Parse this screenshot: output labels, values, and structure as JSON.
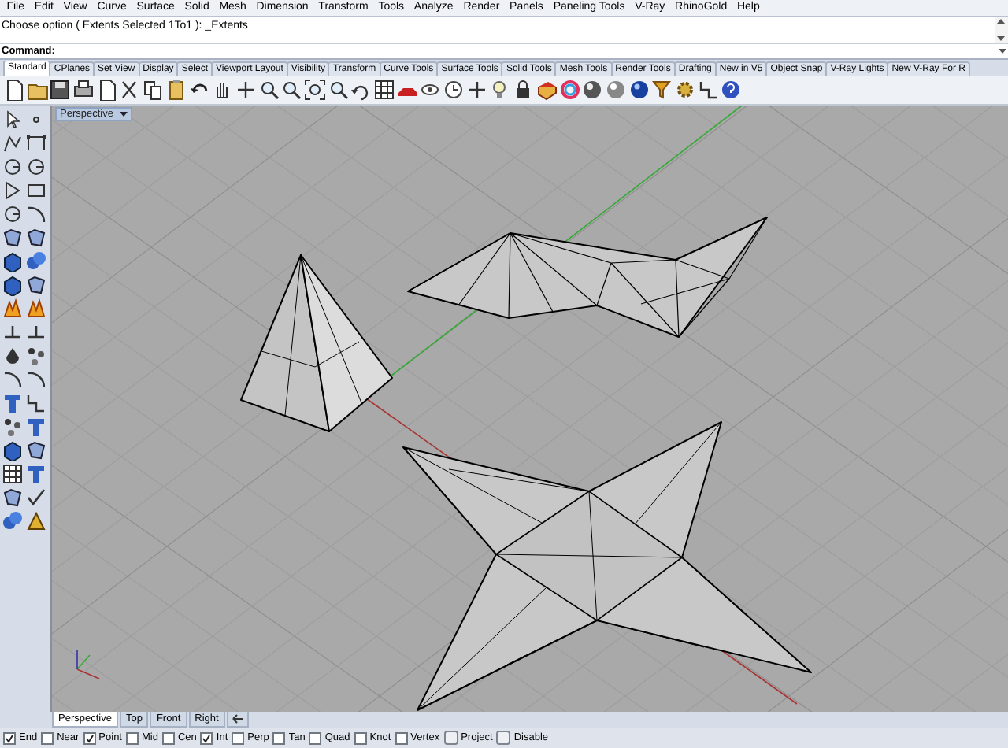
{
  "menu": [
    "File",
    "Edit",
    "View",
    "Curve",
    "Surface",
    "Solid",
    "Mesh",
    "Dimension",
    "Transform",
    "Tools",
    "Analyze",
    "Render",
    "Panels",
    "Paneling Tools",
    "V-Ray",
    "RhinoGold",
    "Help"
  ],
  "command_history": {
    "text": "Choose option ( Extents  Selected  1To1 ): _Extents"
  },
  "command_line": {
    "label": "Command:"
  },
  "toolbar_tabs": [
    {
      "label": "Standard",
      "selected": true
    },
    {
      "label": "CPlanes",
      "selected": false
    },
    {
      "label": "Set View",
      "selected": false
    },
    {
      "label": "Display",
      "selected": false
    },
    {
      "label": "Select",
      "selected": false
    },
    {
      "label": "Viewport Layout",
      "selected": false
    },
    {
      "label": "Visibility",
      "selected": false
    },
    {
      "label": "Transform",
      "selected": false
    },
    {
      "label": "Curve Tools",
      "selected": false
    },
    {
      "label": "Surface Tools",
      "selected": false
    },
    {
      "label": "Solid Tools",
      "selected": false
    },
    {
      "label": "Mesh Tools",
      "selected": false
    },
    {
      "label": "Render Tools",
      "selected": false
    },
    {
      "label": "Drafting",
      "selected": false
    },
    {
      "label": "New in V5",
      "selected": false
    },
    {
      "label": "Object Snap",
      "selected": false
    },
    {
      "label": "V-Ray Lights",
      "selected": false
    },
    {
      "label": "New V-Ray For R",
      "selected": false
    }
  ],
  "viewport": {
    "title": "Perspective"
  },
  "viewport_tabs": [
    {
      "label": "Perspective",
      "selected": true
    },
    {
      "label": "Top",
      "selected": false
    },
    {
      "label": "Front",
      "selected": false
    },
    {
      "label": "Right",
      "selected": false
    }
  ],
  "osnaps": [
    {
      "label": "End",
      "checked": true,
      "kind": "checkbox"
    },
    {
      "label": "Near",
      "checked": false,
      "kind": "checkbox"
    },
    {
      "label": "Point",
      "checked": true,
      "kind": "checkbox"
    },
    {
      "label": "Mid",
      "checked": false,
      "kind": "checkbox"
    },
    {
      "label": "Cen",
      "checked": false,
      "kind": "checkbox"
    },
    {
      "label": "Int",
      "checked": true,
      "kind": "checkbox"
    },
    {
      "label": "Perp",
      "checked": false,
      "kind": "checkbox"
    },
    {
      "label": "Tan",
      "checked": false,
      "kind": "checkbox"
    },
    {
      "label": "Quad",
      "checked": false,
      "kind": "checkbox"
    },
    {
      "label": "Knot",
      "checked": false,
      "kind": "checkbox"
    },
    {
      "label": "Vertex",
      "checked": false,
      "kind": "checkbox"
    },
    {
      "label": "Project",
      "checked": false,
      "kind": "toggle"
    },
    {
      "label": "Disable",
      "checked": false,
      "kind": "toggle"
    }
  ]
}
